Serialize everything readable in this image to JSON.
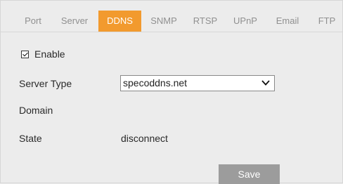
{
  "tabs": [
    {
      "label": "Port",
      "active": false
    },
    {
      "label": "Server",
      "active": false
    },
    {
      "label": "DDNS",
      "active": true
    },
    {
      "label": "SNMP",
      "active": false
    },
    {
      "label": "RTSP",
      "active": false
    },
    {
      "label": "UPnP",
      "active": false
    },
    {
      "label": "Email",
      "active": false
    },
    {
      "label": "FTP",
      "active": false
    }
  ],
  "form": {
    "enable_label": "Enable",
    "enable_checked": true,
    "server_type_label": "Server Type",
    "server_type_value": "specoddns.net",
    "domain_label": "Domain",
    "state_label": "State",
    "state_value": "disconnect"
  },
  "actions": {
    "save_label": "Save"
  },
  "colors": {
    "active_tab": "#f29a2e",
    "save_button": "#9c9c9c",
    "background": "#ececec"
  }
}
